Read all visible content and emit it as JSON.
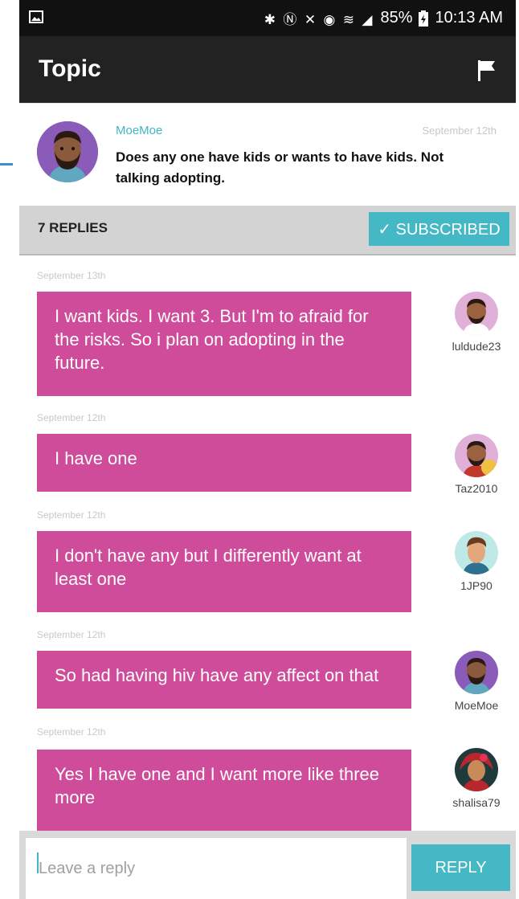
{
  "status_bar": {
    "icons": [
      "image-icon",
      "bluetooth-icon",
      "nfc-icon",
      "mute-icon",
      "alarm-icon",
      "wifi-icon",
      "signal-icon",
      "battery-icon"
    ],
    "battery": "85%",
    "time": "10:13 AM"
  },
  "appbar": {
    "title": "Topic",
    "flag_icon": "flag-icon"
  },
  "topic": {
    "author": "MoeMoe",
    "date": "September 12th",
    "text": "Does any one have kids or wants to have kids. Not talking adopting."
  },
  "replies_bar": {
    "count_label": "7 REPLIES",
    "subscribed_label": "✓ SUBSCRIBED"
  },
  "messages": [
    {
      "date": "September 13th",
      "text": "I want kids. I want 3. But I'm to afraid for the risks. So i plan on adopting in the future.",
      "username": "luldude23"
    },
    {
      "date": "September 12th",
      "text": "I have one",
      "username": "Taz2010"
    },
    {
      "date": "September 12th",
      "text": "I don't have any but I differently want at least one",
      "username": "1JP90"
    },
    {
      "date": "September 12th",
      "text": "So had having hiv have any affect on that",
      "username": "MoeMoe"
    },
    {
      "date": "September 12th",
      "text": "Yes I have one and I want more like three more",
      "username": "shalisa79"
    }
  ],
  "footer": {
    "placeholder": "Leave a reply",
    "reply_label": "REPLY"
  },
  "colors": {
    "accent": "#44b8c4",
    "bubble": "#cf4c9b",
    "appbar": "#222222"
  }
}
